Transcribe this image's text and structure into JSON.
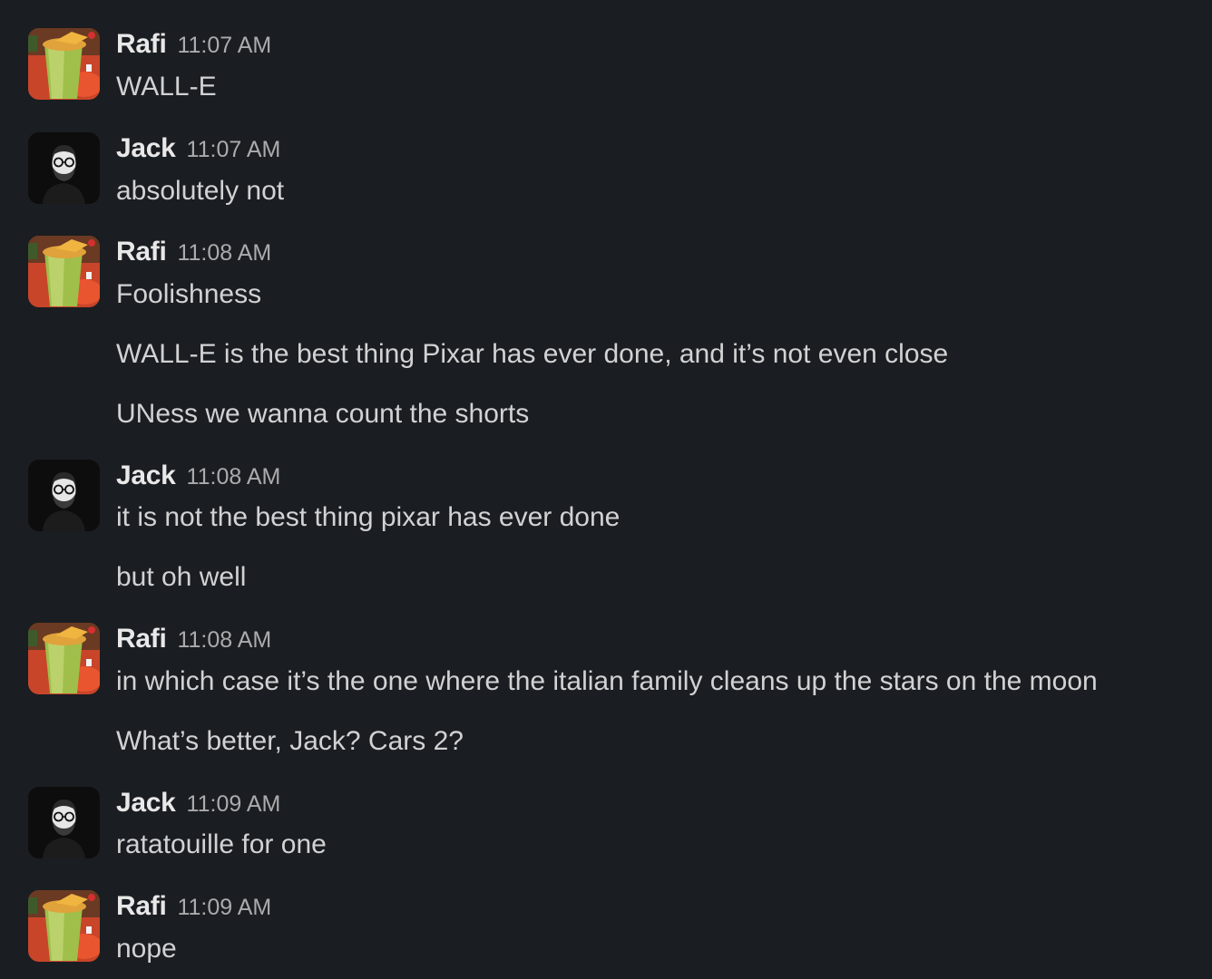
{
  "users": {
    "rafi": {
      "name": "Rafi",
      "avatar_icon": "green-drink-avatar-icon"
    },
    "jack": {
      "name": "Jack",
      "avatar_icon": "bearded-man-glasses-avatar-icon"
    }
  },
  "messages": [
    {
      "author": "Rafi",
      "time": "11:07 AM",
      "lines": [
        "WALL-E"
      ]
    },
    {
      "author": "Jack",
      "time": "11:07 AM",
      "lines": [
        "absolutely not"
      ]
    },
    {
      "author": "Rafi",
      "time": "11:08 AM",
      "lines": [
        "Foolishness",
        "WALL-E is the best thing Pixar has ever done, and it’s not even close",
        "UNess we wanna count the shorts"
      ]
    },
    {
      "author": "Jack",
      "time": "11:08 AM",
      "lines": [
        "it is not the best thing pixar has ever done",
        "but oh well"
      ]
    },
    {
      "author": "Rafi",
      "time": "11:08 AM",
      "lines": [
        "in which case it’s the one where the italian family cleans up the stars on the moon",
        "What’s better, Jack? Cars 2?"
      ]
    },
    {
      "author": "Jack",
      "time": "11:09 AM",
      "lines": [
        "ratatouille for one"
      ]
    },
    {
      "author": "Rafi",
      "time": "11:09 AM",
      "lines": [
        "nope"
      ]
    }
  ],
  "colors": {
    "background": "#1a1d21",
    "text": "#d1d2d3",
    "author": "#e8e8e8",
    "timestamp": "#ababad"
  }
}
